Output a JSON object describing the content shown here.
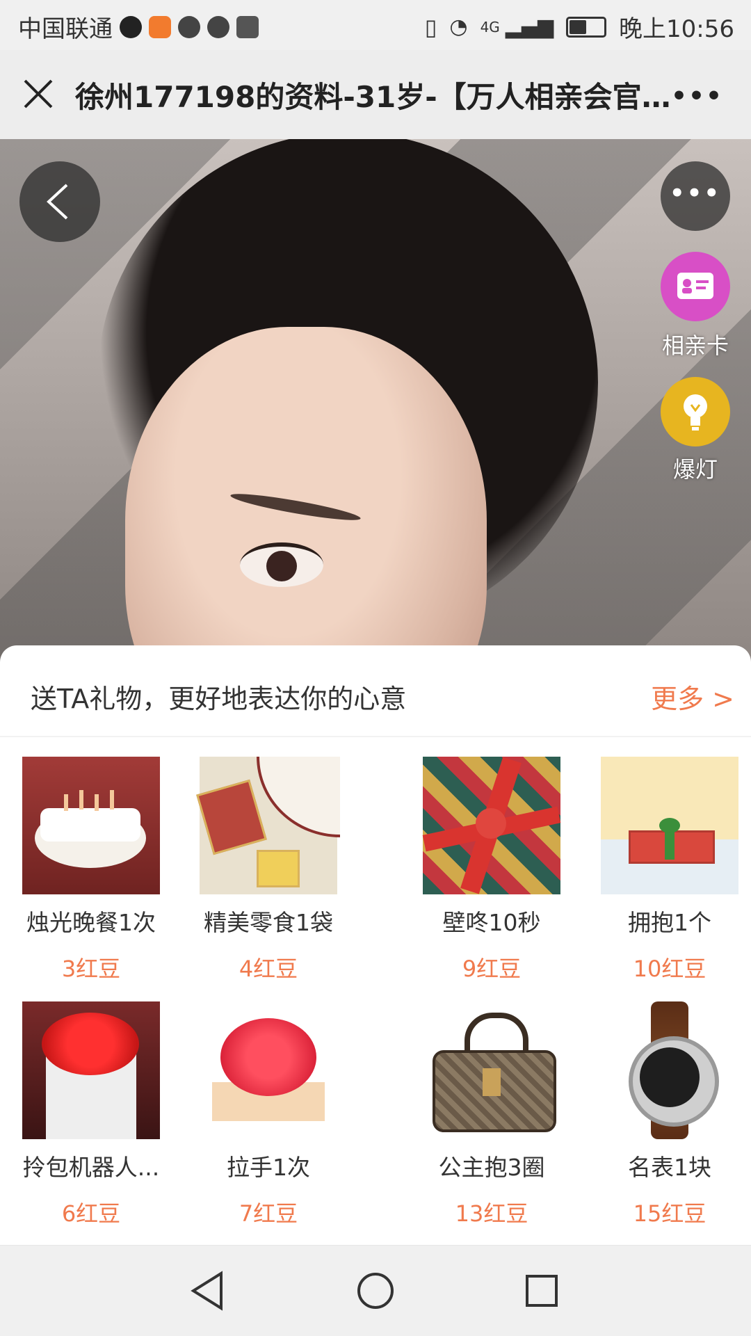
{
  "status": {
    "carrier": "中国联通",
    "network": "4G",
    "time": "晚上10:56"
  },
  "header": {
    "title": "徐州177198的资料-31岁-【万人相亲会官…",
    "more": "•••"
  },
  "profile": {
    "more": "•••",
    "actions": [
      {
        "label": "相亲卡"
      },
      {
        "label": "爆灯"
      }
    ]
  },
  "gifts": {
    "heading": "送TA礼物，更好地表达你的心意",
    "more_label": "更多 >",
    "items": [
      {
        "name": "烛光晚餐1次",
        "price": "3红豆"
      },
      {
        "name": "精美零食1袋",
        "price": "4红豆"
      },
      {
        "name": "壁咚10秒",
        "price": "9红豆"
      },
      {
        "name": "拥抱1个",
        "price": "10红豆"
      },
      {
        "name": "拎包机器人...",
        "price": "6红豆"
      },
      {
        "name": "拉手1次",
        "price": "7红豆"
      },
      {
        "name": "公主抱3圈",
        "price": "13红豆"
      },
      {
        "name": "名表1块",
        "price": "15红豆"
      }
    ]
  },
  "colors": {
    "accent": "#f07a4d",
    "card_badge": "#d84fc6",
    "bulb_badge": "#e7b520"
  }
}
